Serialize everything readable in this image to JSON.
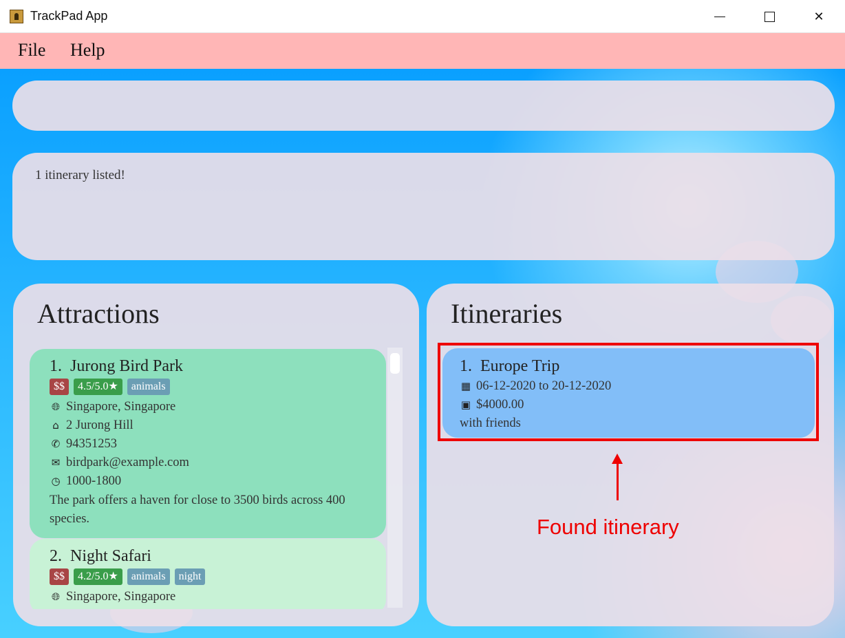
{
  "window": {
    "title": "TrackPad App",
    "icon": "app-icon"
  },
  "menu": {
    "items": [
      "File",
      "Help"
    ]
  },
  "command_box": {
    "value": "",
    "placeholder": ""
  },
  "result": {
    "text": "1 itinerary listed!"
  },
  "attractions": {
    "title": "Attractions",
    "items": [
      {
        "index": "1.",
        "name": "Jurong Bird Park",
        "price": "$$",
        "rating": "4.5/5.0★",
        "tags": [
          "animals"
        ],
        "location": "Singapore, Singapore",
        "address": "2 Jurong Hill",
        "phone": "94351253",
        "email": "birdpark@example.com",
        "hours": "1000-1800",
        "description": "The park offers a haven for close to 3500 birds across 400 species."
      },
      {
        "index": "2.",
        "name": "Night Safari",
        "price": "$$",
        "rating": "4.2/5.0★",
        "tags": [
          "animals",
          "night"
        ],
        "location": "Singapore, Singapore"
      }
    ]
  },
  "itineraries": {
    "title": "Itineraries",
    "items": [
      {
        "index": "1.",
        "name": "Europe Trip",
        "dates": "06-12-2020 to 20-12-2020",
        "budget": "$4000.00",
        "description": "with friends"
      }
    ]
  },
  "annotation": {
    "text": "Found itinerary",
    "color": "#ee0000"
  },
  "colors": {
    "menubar": "#ffb6b6",
    "attraction_card_selected": "#8de0bd",
    "attraction_card": "#c8f2d6",
    "itinerary_card": "#82bef8",
    "price_tag": "#a84545",
    "rating_tag": "#3a9d4a",
    "label_tag": "#6b9eb4"
  }
}
